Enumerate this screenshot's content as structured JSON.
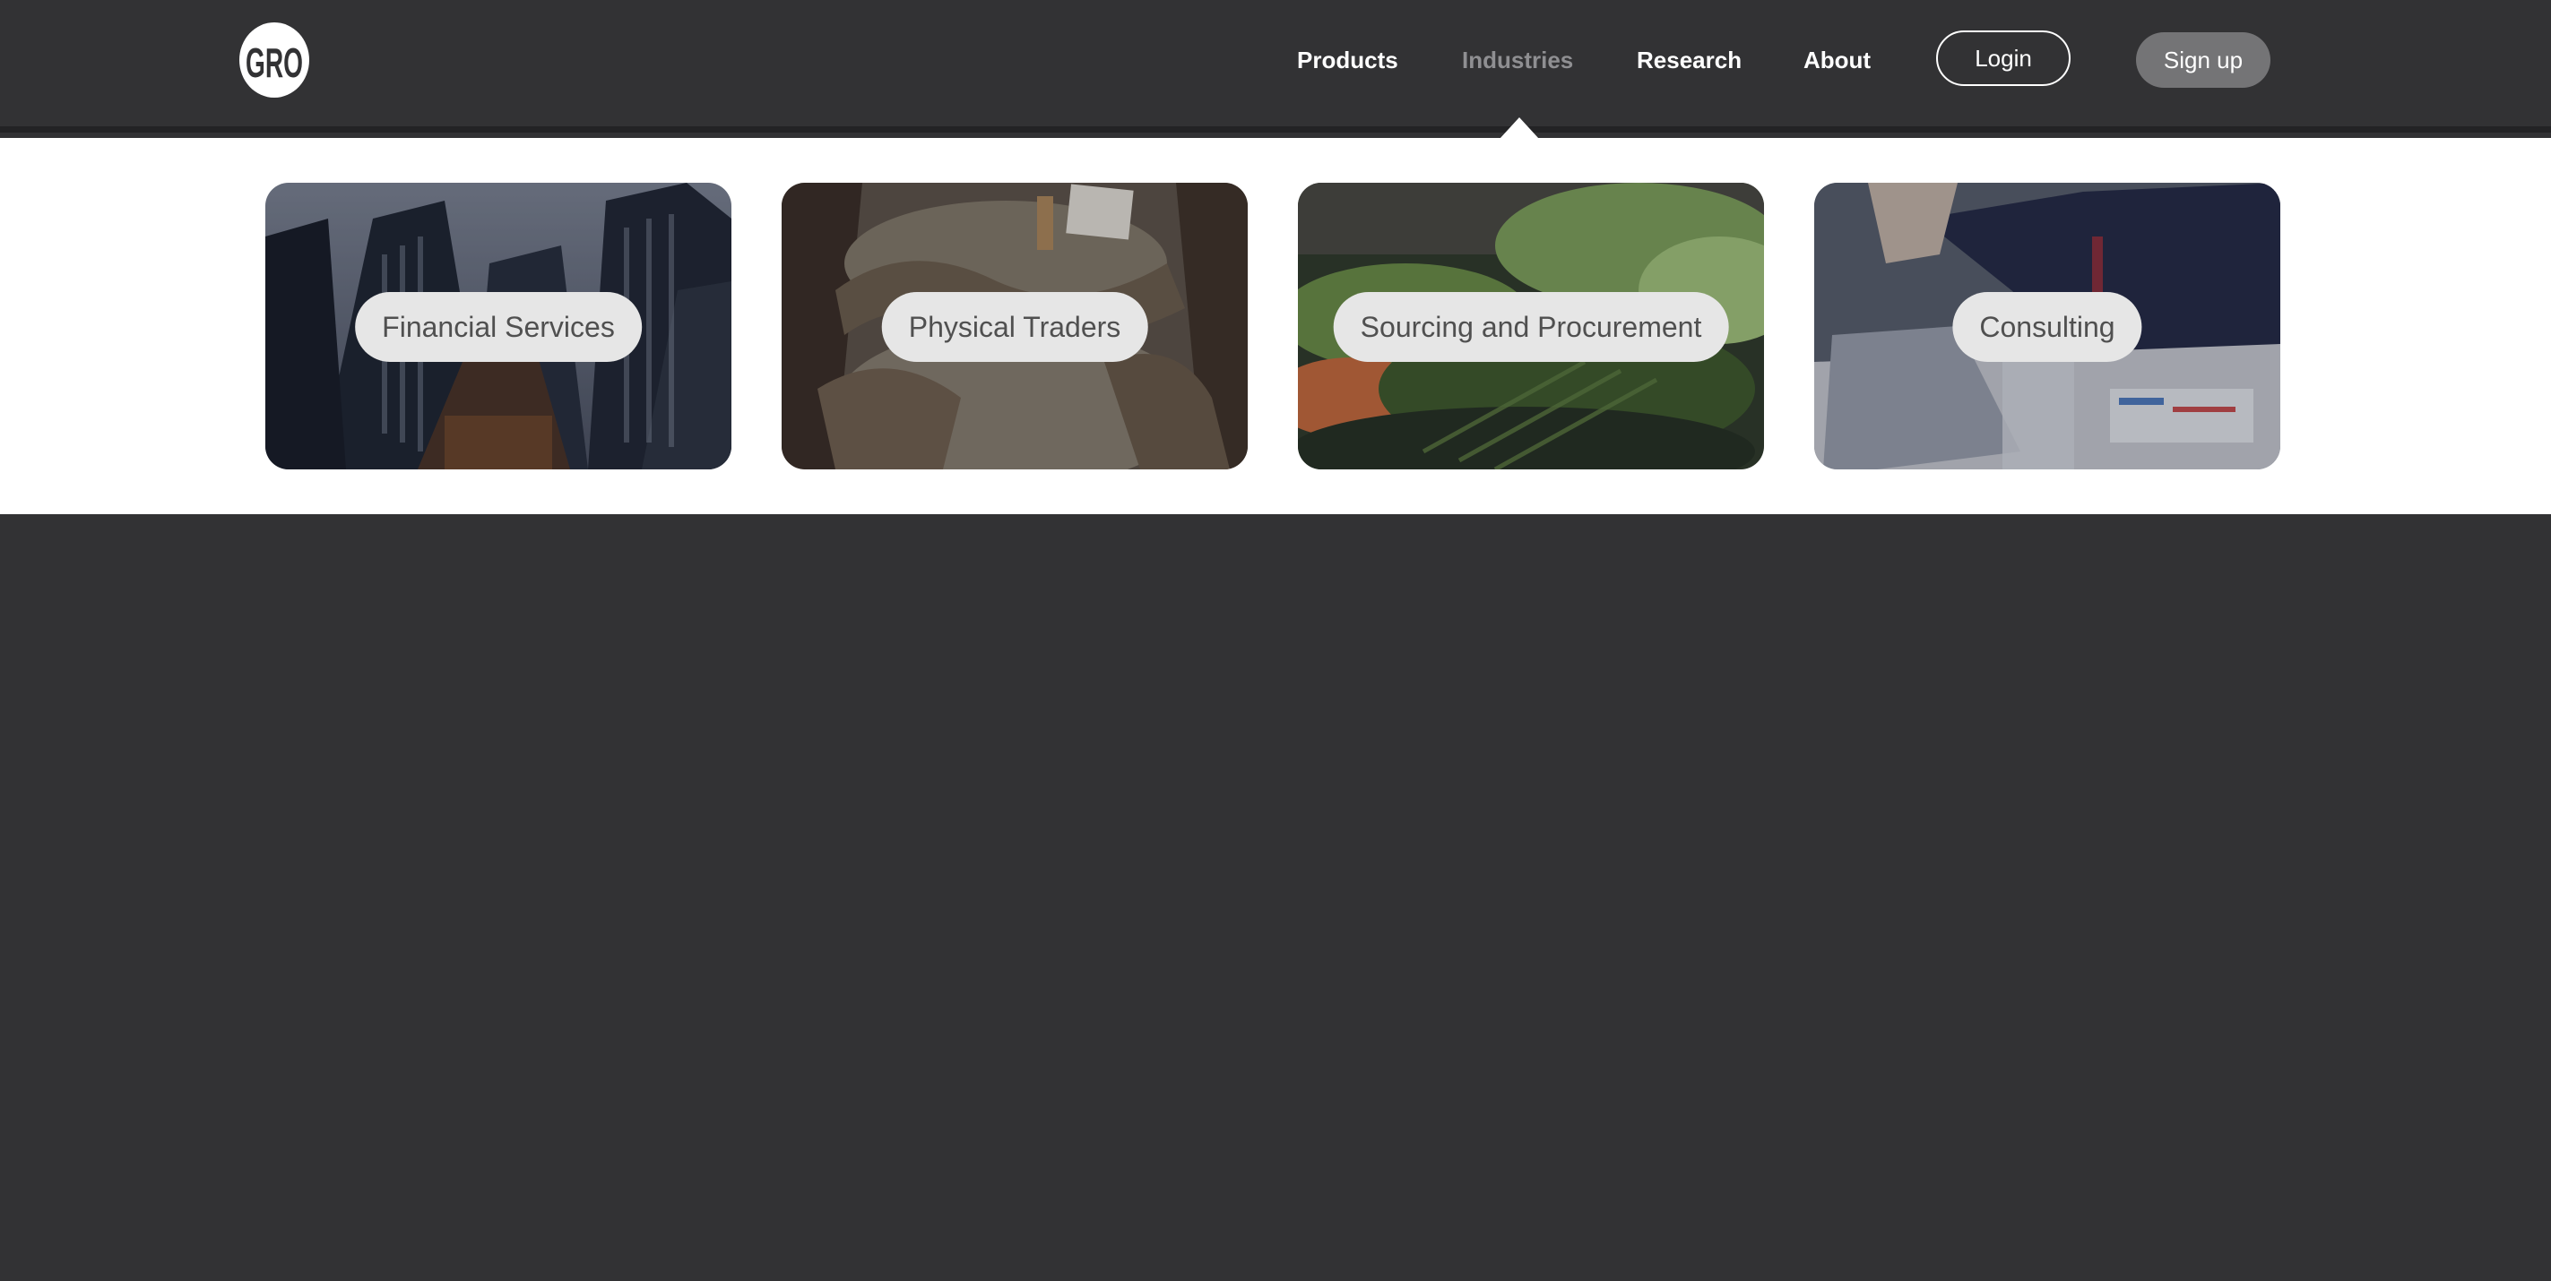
{
  "brand": {
    "logo_text": "GRO"
  },
  "nav": {
    "links": [
      {
        "label": "Products",
        "active": false
      },
      {
        "label": "Industries",
        "active": true
      },
      {
        "label": "Research",
        "active": false
      },
      {
        "label": "About",
        "active": false
      }
    ],
    "login_label": "Login",
    "signup_label": "Sign up"
  },
  "industries_menu": {
    "cards": [
      {
        "label": "Financial Services",
        "image": "skyscrapers"
      },
      {
        "label": "Physical Traders",
        "image": "grain-sacks"
      },
      {
        "label": "Sourcing and Procurement",
        "image": "vegetables"
      },
      {
        "label": "Consulting",
        "image": "business-meeting"
      }
    ]
  },
  "colors": {
    "background": "#323234",
    "dropdown": "#ffffff",
    "active_link": "#8f8f92",
    "signup": "#747476",
    "pill": "#e6e6e6"
  }
}
